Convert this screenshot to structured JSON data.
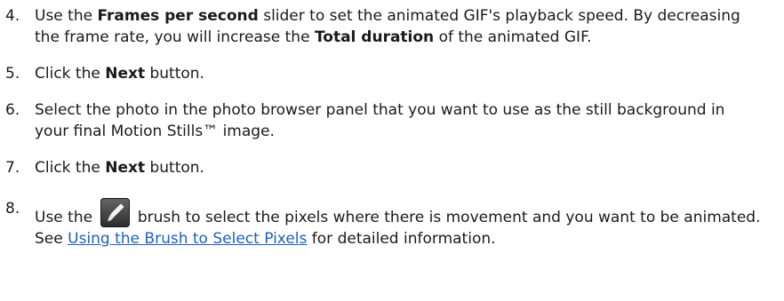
{
  "steps": [
    {
      "num": "4.",
      "t1": "Use the ",
      "b1": "Frames per second",
      "t2": " slider to set the animated GIF's playback speed. By decreasing the frame rate, you will increase the ",
      "b2": "Total duration",
      "t3": " of the animated GIF."
    },
    {
      "num": "5.",
      "t1": "Click the ",
      "b1": "Next",
      "t2": " button."
    },
    {
      "num": "6.",
      "t1": "Select the photo in the photo browser panel that you want to use as the still background in your final Motion Stills™ image."
    },
    {
      "num": "7.",
      "t1": "Click the ",
      "b1": "Next",
      "t2": " button."
    },
    {
      "num": "8.",
      "t1": "Use the ",
      "icon": "brush-icon",
      "t2": " brush to select the pixels where there is movement and you want to be animated. See ",
      "link": "Using the Brush to Select Pixels",
      "t3": " for detailed information."
    }
  ]
}
